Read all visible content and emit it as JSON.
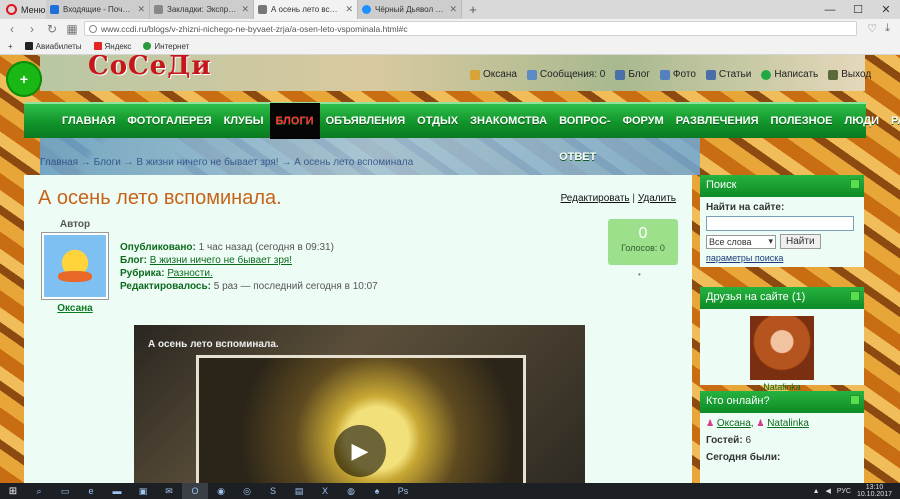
{
  "browser": {
    "menu_label": "Меню",
    "tabs": [
      {
        "title": "Входящие - Почта Mail.R",
        "color": "#1e6fd9"
      },
      {
        "title": "Закладки: Экспресс-пане",
        "color": "#888888"
      },
      {
        "title": "А осень лето вспоминала",
        "color": "#777777",
        "active": true
      },
      {
        "title": "Чёрный Дьявол 1993 смо",
        "color": "#1e90ff"
      }
    ],
    "url": "www.ccdi.ru/blogs/v-zhizni-nichego-ne-byvaet-zrja/a-osen-leto-vspominala.html#c",
    "bookmarks": [
      "Авиабилеты",
      "Яндекс",
      "Интернет"
    ]
  },
  "site": {
    "logo": "СоСеДи",
    "userbar": [
      {
        "label": "Оксана",
        "color": "#d6a338"
      },
      {
        "label": "Сообщения: 0",
        "color": "#5c8ac4"
      },
      {
        "label": "Блог",
        "color": "#4a6fa8"
      },
      {
        "label": "Фото",
        "color": "#5580c0"
      },
      {
        "label": "Статьи",
        "color": "#4a6fa8"
      },
      {
        "label": "Написать",
        "color": "#22a845"
      },
      {
        "label": "Выход",
        "color": "#5a6a3a"
      }
    ],
    "menu": [
      "ГЛАВНАЯ",
      "ФОТОГАЛЕРЕЯ",
      "КЛУБЫ",
      "БЛОГИ",
      "ОБЪЯВЛЕНИЯ",
      "ОТДЫХ",
      "ЗНАКОМСТВА",
      "ВОПРОС-ОТВЕТ",
      "ФОРУМ",
      "РАЗВЛЕЧЕНИЯ",
      "ПОЛЕЗНОЕ",
      "ЛЮДИ",
      "РАССКАЗЫ"
    ],
    "menu_active": "БЛОГИ",
    "breadcrumb": "Главная → Блоги → В жизни ничего не бывает зря! → А осень лето вспоминала"
  },
  "post": {
    "title": "А осень лето вспоминала.",
    "edit": "Редактировать",
    "separator": "|",
    "delete": "Удалить",
    "author_label": "Автор",
    "author_name": "Оксана",
    "published_label": "Опубликовано:",
    "published_value": "1 час назад (сегодня в 09:31)",
    "blog_label": "Блог:",
    "blog_value": "В жизни ничего не бывает зря!",
    "rubric_label": "Рубрика:",
    "rubric_value": "Разности.",
    "edited_label": "Редактировалось:",
    "edited_value": "5 раз — последний сегодня в 10:07",
    "votes_count": "0",
    "votes_label": "Голосов: 0",
    "video_title": "А осень лето вспоминала."
  },
  "sidebar": {
    "search": {
      "title": "Поиск",
      "label": "Найти на сайте:",
      "select": "Все слова",
      "button": "Найти",
      "params": "параметры поиска"
    },
    "friends": {
      "title": "Друзья на сайте (1)",
      "name": "Natalinka"
    },
    "online": {
      "title": "Кто онлайн?",
      "users": [
        "Оксана",
        "Natalinka"
      ],
      "guests_label": "Гостей:",
      "guests_value": "6",
      "today_label": "Сегодня были:"
    }
  },
  "taskbar": {
    "lang": "РУС",
    "time": "13:10",
    "date": "10.10.2017"
  }
}
